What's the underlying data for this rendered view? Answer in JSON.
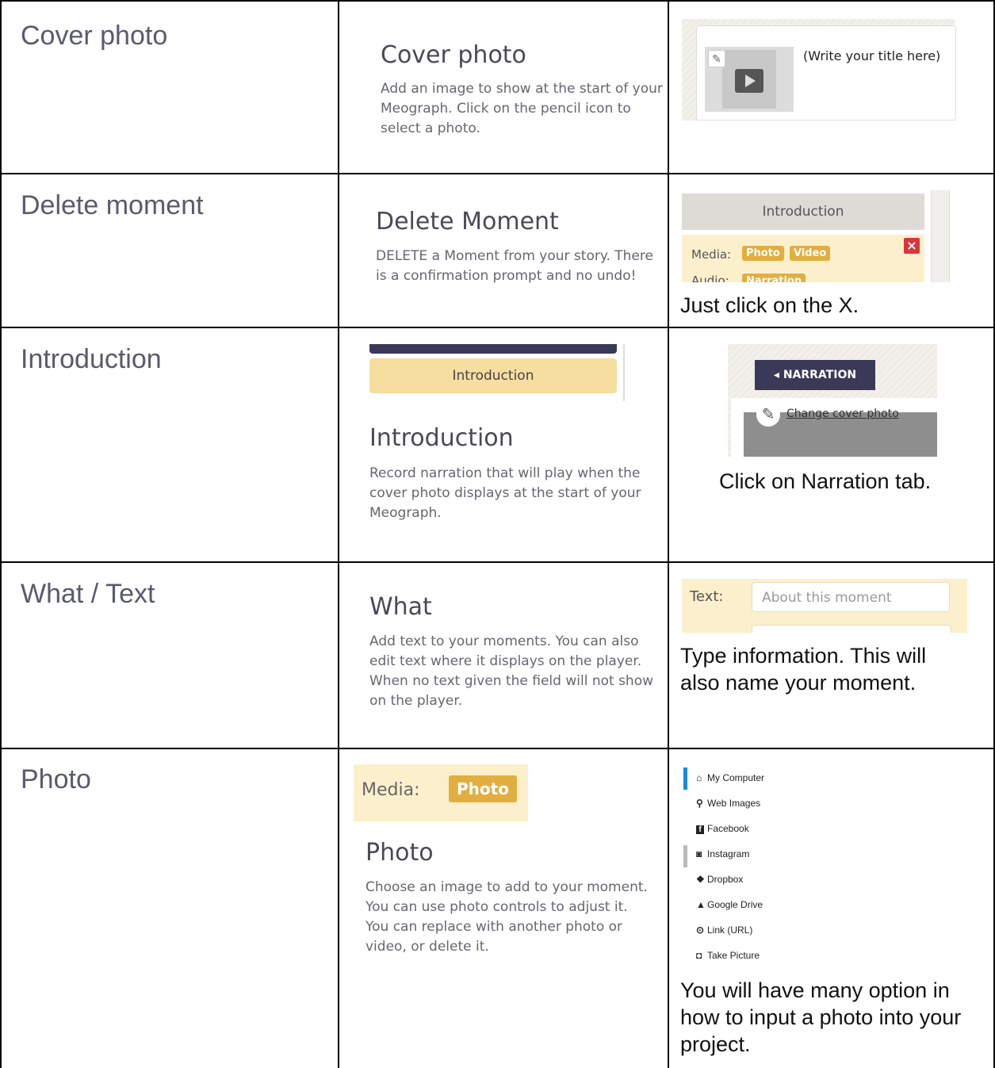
{
  "rows": [
    {
      "label": "Cover photo",
      "mid_title": "Cover photo",
      "mid_desc": "Add an image to show at the start of your Meograph. Click on the pencil icon to select a photo.",
      "shot_title_placeholder": "(Write your title here)"
    },
    {
      "label": "Delete moment",
      "mid_title": "Delete Moment",
      "mid_desc": "DELETE a Moment from your story. There is a confirmation prompt and no undo!",
      "shot_header": "Introduction",
      "shot_media_label": "Media:",
      "shot_photo_chip": "Photo",
      "shot_video_chip": "Video",
      "shot_audio_label": "Audio:",
      "shot_narration_chip": "Narration",
      "shot_close": "×",
      "note": "Just click on the X."
    },
    {
      "label": "Introduction",
      "mid_shot_button": "Introduction",
      "mid_title": "Introduction",
      "mid_desc": "Record narration that will play when the cover photo displays at the start of your Meograph.",
      "shot_tab": "◂ NARRATION",
      "shot_link": "Change cover photo",
      "note": "Click on Narration tab."
    },
    {
      "label": "What / Text",
      "mid_title": "What",
      "mid_desc": "Add text to your moments. You can also edit text where it displays on the player. When no text given the field will not show on the player.",
      "shot_text_label": "Text:",
      "shot_text_placeholder": "About this moment",
      "note_line1": "Type information.  This will",
      "note_line2": "also name your moment."
    },
    {
      "label": "Photo",
      "mid_shot_label": "Media:",
      "mid_shot_chip": "Photo",
      "mid_title": "Photo",
      "mid_desc": "Choose an image to add to your moment. You can use photo controls to adjust it. You can replace with another photo or video, or delete it.",
      "sources": [
        {
          "icon": "home-icon",
          "glyph": "⌂",
          "label": "My Computer"
        },
        {
          "icon": "search-icon",
          "glyph": "⚲",
          "label": "Web Images"
        },
        {
          "icon": "facebook-icon",
          "glyph": "f",
          "label": "Facebook"
        },
        {
          "icon": "instagram-icon",
          "glyph": "◙",
          "label": "Instagram"
        },
        {
          "icon": "dropbox-icon",
          "glyph": "❖",
          "label": "Dropbox"
        },
        {
          "icon": "google-drive-icon",
          "glyph": "▲",
          "label": "Google Drive"
        },
        {
          "icon": "link-icon",
          "glyph": "⊙",
          "label": "Link (URL)"
        },
        {
          "icon": "camera-icon",
          "glyph": "◘",
          "label": "Take Picture"
        }
      ],
      "note_line1": "You will have many option in",
      "note_line2": "how to input a photo into your",
      "note_line3": "project."
    }
  ]
}
